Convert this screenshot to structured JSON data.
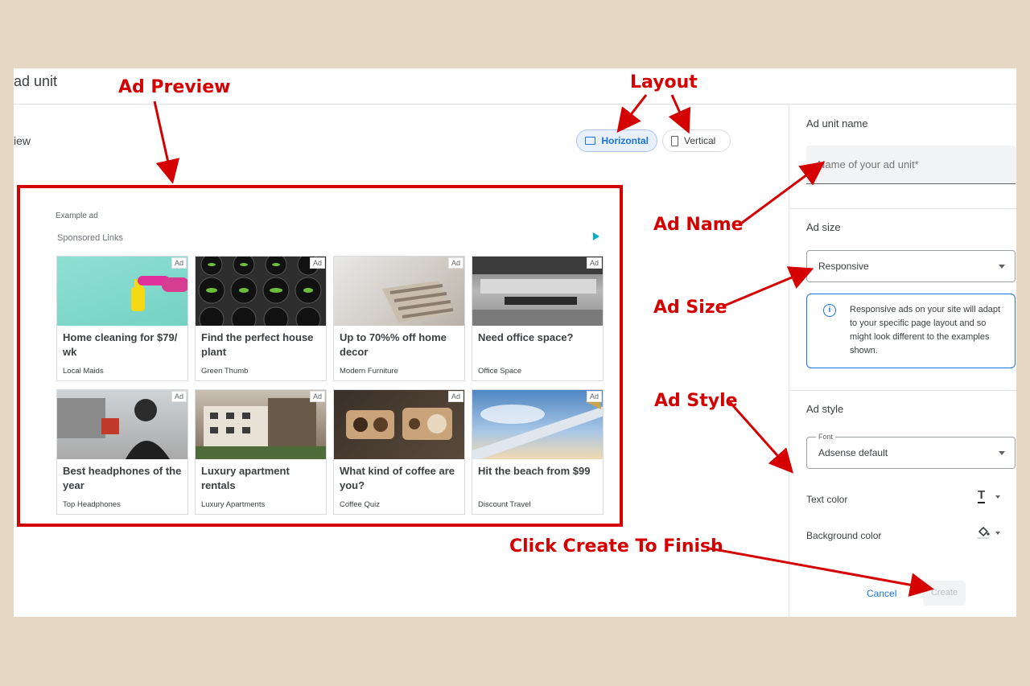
{
  "page": {
    "title": "ad unit",
    "preview_label": "iew"
  },
  "layout_toggle": {
    "horizontal": "Horizontal",
    "vertical": "Vertical"
  },
  "preview": {
    "example_label": "Example ad",
    "sponsored_label": "Sponsored Links",
    "ad_badge": "Ad",
    "cards": [
      {
        "title": "Home cleaning for $79/ wk",
        "advertiser": "Local Maids"
      },
      {
        "title": "Find the perfect house plant",
        "advertiser": "Green Thumb"
      },
      {
        "title": "Up to 70%% off home decor",
        "advertiser": "Modern Furniture"
      },
      {
        "title": "Need office space?",
        "advertiser": "Office Space"
      },
      {
        "title": "Best headphones of the year",
        "advertiser": "Top Headphones"
      },
      {
        "title": "Luxury apartment rentals",
        "advertiser": "Luxury Apartments"
      },
      {
        "title": "What kind of coffee are you?",
        "advertiser": "Coffee Quiz"
      },
      {
        "title": "Hit the beach from $99",
        "advertiser": "Discount Travel"
      }
    ]
  },
  "sidebar": {
    "ad_unit_name_label": "Ad unit name",
    "ad_unit_name_placeholder": "Name of your ad unit*",
    "ad_size_label": "Ad size",
    "ad_size_value": "Responsive",
    "info_text": "Responsive ads on your site will adapt to your specific page layout and so might look different to the examples shown.",
    "ad_style_label": "Ad style",
    "font_label": "Font",
    "font_value": "Adsense default",
    "text_color_label": "Text color",
    "background_color_label": "Background color",
    "cancel": "Cancel",
    "create": "Create"
  },
  "annotations": {
    "ad_preview": "Ad Preview",
    "layout": "Layout",
    "ad_name": "Ad Name",
    "ad_size": "Ad Size",
    "ad_style": "Ad Style",
    "click_create": "Click Create To Finish"
  },
  "colors": {
    "annotation_red": "#d50000",
    "accent_blue": "#1a73e8",
    "background": "#e6d7c4"
  }
}
